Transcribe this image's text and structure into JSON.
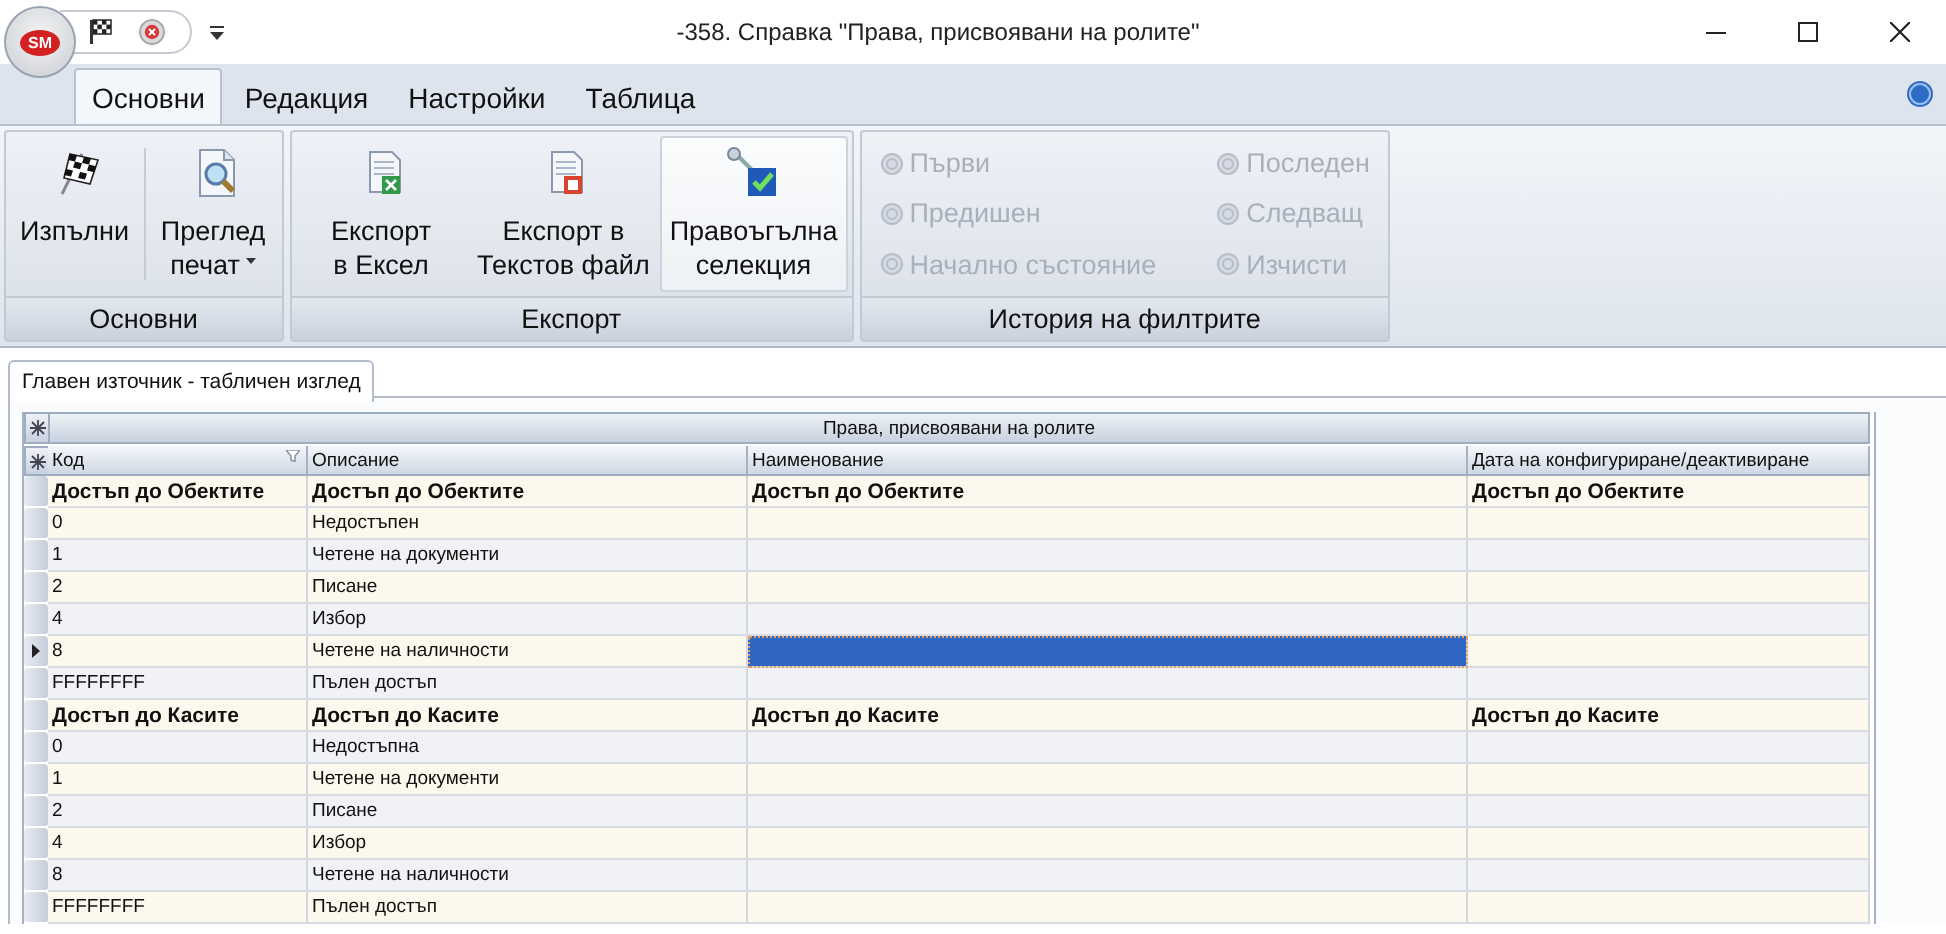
{
  "window": {
    "app_badge": "SM",
    "title": "-358. Справка \"Права, присвоявани на ролите\""
  },
  "ribbon": {
    "tabs": [
      {
        "label": "Основни",
        "selected": true
      },
      {
        "label": "Редакция",
        "selected": false
      },
      {
        "label": "Настройки",
        "selected": false
      },
      {
        "label": "Таблица",
        "selected": false
      }
    ],
    "groups": [
      {
        "kind": "buttons",
        "label": "Основни",
        "buttons": [
          {
            "label": "Изпълни",
            "pressed": false,
            "dropdown": false
          },
          {
            "label": "Преглед печат",
            "pressed": false,
            "dropdown": true
          }
        ]
      },
      {
        "kind": "buttons",
        "label": "Експорт",
        "buttons": [
          {
            "label": "Експорт в Ексел",
            "pressed": false,
            "dropdown": false
          },
          {
            "label": "Експорт в Текстов файл",
            "pressed": false,
            "dropdown": false
          },
          {
            "label": "Правоъгълна селекция",
            "pressed": true,
            "dropdown": false
          }
        ]
      },
      {
        "kind": "list",
        "label": "История на филтрите",
        "items": [
          {
            "label": "Първи",
            "disabled": true
          },
          {
            "label": "Последен",
            "disabled": true
          },
          {
            "label": "Предишен",
            "disabled": true
          },
          {
            "label": "Следващ",
            "disabled": true
          },
          {
            "label": "Начално състояние",
            "disabled": true
          },
          {
            "label": "Изчисти",
            "disabled": true
          }
        ]
      }
    ]
  },
  "document_tab": {
    "label": "Главен източник - табличен изглед",
    "selected": true
  },
  "table": {
    "band": "Права, присвоявани на ролите",
    "columns": [
      "Код",
      "Описание",
      "Наименование",
      "Дата на конфигуриране/деактивиране"
    ],
    "rows": [
      {
        "kind": "group",
        "cells": [
          "Достъп до Обектите",
          "Достъп до Обектите",
          "Достъп до Обектите",
          "Достъп до Обектите"
        ],
        "selected": false
      },
      {
        "kind": "data",
        "cells": [
          "0",
          "Недостъпен"
        ],
        "selected": false
      },
      {
        "kind": "data",
        "cells": [
          "1",
          "Четене на документи"
        ],
        "selected": false
      },
      {
        "kind": "data",
        "cells": [
          "2",
          "Писане"
        ],
        "selected": false
      },
      {
        "kind": "data",
        "cells": [
          "4",
          "Избор"
        ],
        "selected": false
      },
      {
        "kind": "data",
        "cells": [
          "8",
          "Четене на наличности"
        ],
        "selected": true
      },
      {
        "kind": "data",
        "cells": [
          "FFFFFFFF",
          "Пълен достъп"
        ],
        "selected": false
      },
      {
        "kind": "group",
        "cells": [
          "Достъп до Касите",
          "Достъп до Касите",
          "Достъп до Касите",
          "Достъп до Касите"
        ],
        "selected": false
      },
      {
        "kind": "data",
        "cells": [
          "0",
          "Недостъпна"
        ],
        "selected": false
      },
      {
        "kind": "data",
        "cells": [
          "1",
          "Четене на документи"
        ],
        "selected": false
      },
      {
        "kind": "data",
        "cells": [
          "2",
          "Писане"
        ],
        "selected": false
      },
      {
        "kind": "data",
        "cells": [
          "4",
          "Избор"
        ],
        "selected": false
      },
      {
        "kind": "data",
        "cells": [
          "8",
          "Четене на наличности"
        ],
        "selected": false
      },
      {
        "kind": "data",
        "cells": [
          "FFFFFFFF",
          "Пълен достъп"
        ],
        "selected": false
      }
    ]
  }
}
